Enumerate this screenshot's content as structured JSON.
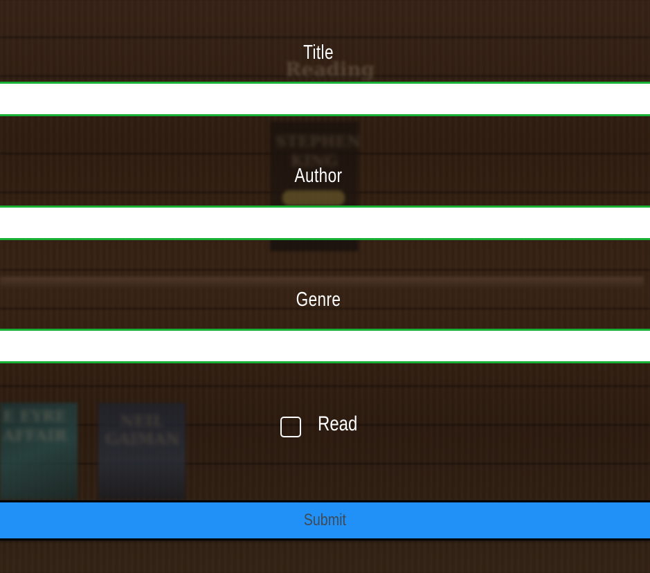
{
  "form": {
    "title_label": "Title",
    "title_value": "",
    "author_label": "Author",
    "author_value": "",
    "genre_label": "Genre",
    "genre_value": "",
    "read_label": "Read",
    "read_checked": false,
    "submit_label": "Submit"
  },
  "background": {
    "shelf_heading": "Reading",
    "book_1_text": "STEPHEN KING",
    "book_2_text": "E EYRE AFFAIR",
    "book_3_text": "NEIL GAIMAN"
  },
  "colors": {
    "field_border": "#18b035",
    "submit_background": "#2191f8",
    "submit_text": "#3f4a56",
    "label_text": "#ffffff"
  }
}
